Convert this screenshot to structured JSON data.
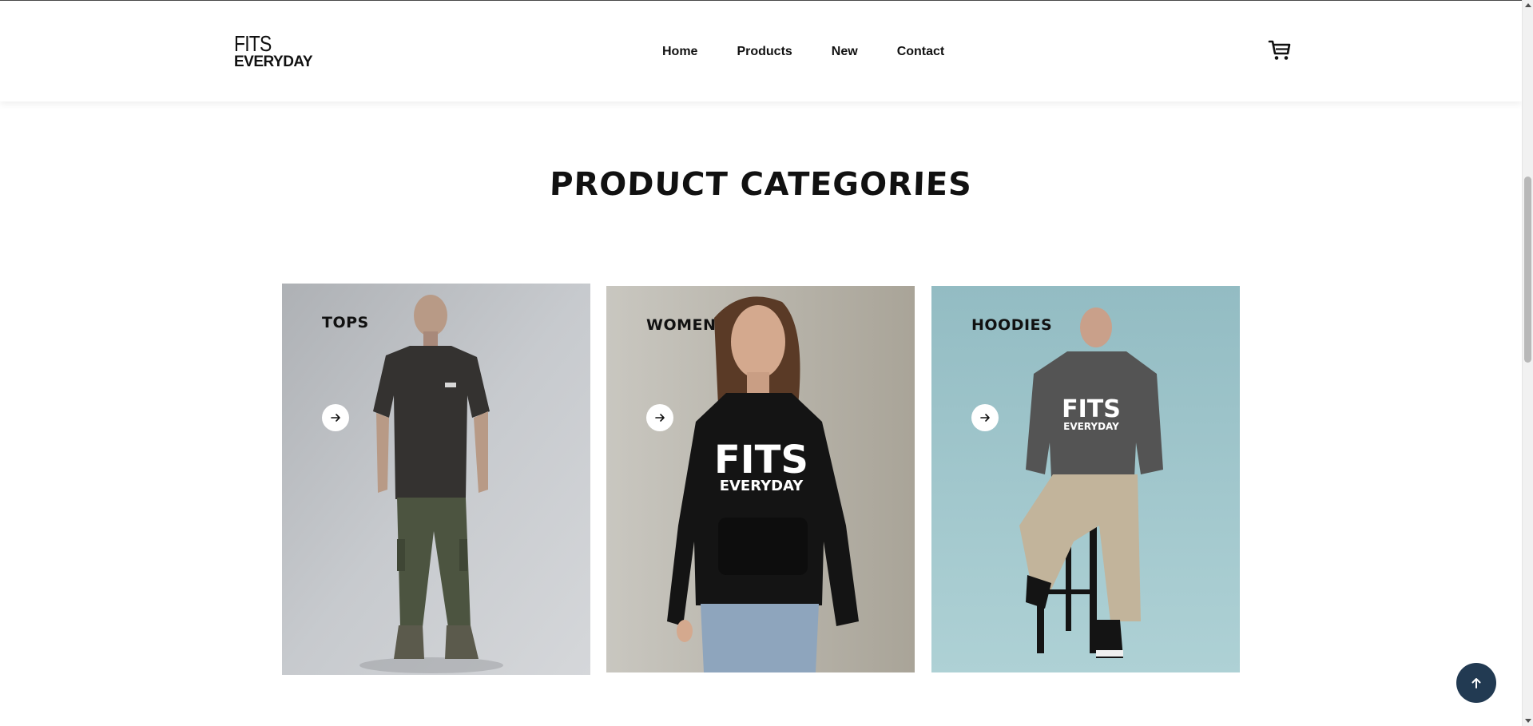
{
  "header": {
    "logo_top": "FITS",
    "logo_bottom": "EVERYDAY",
    "nav": [
      {
        "label": "Home"
      },
      {
        "label": "Products"
      },
      {
        "label": "New"
      },
      {
        "label": "Contact"
      }
    ],
    "cart_icon": "shopping-cart-icon"
  },
  "main": {
    "title": "Product Categories",
    "categories": [
      {
        "label": "Tops",
        "background": "#c4c7cb",
        "icon": "arrow-right-icon"
      },
      {
        "label": "Women",
        "background": "#b9b6ad",
        "icon": "arrow-right-icon"
      },
      {
        "label": "Hoodies",
        "background": "#9fc3c9",
        "icon": "arrow-right-icon"
      }
    ],
    "print_top": "FITS",
    "print_bottom": "EVERYDAY"
  },
  "back_to_top": {
    "icon": "arrow-up-icon",
    "color": "#223a52"
  }
}
